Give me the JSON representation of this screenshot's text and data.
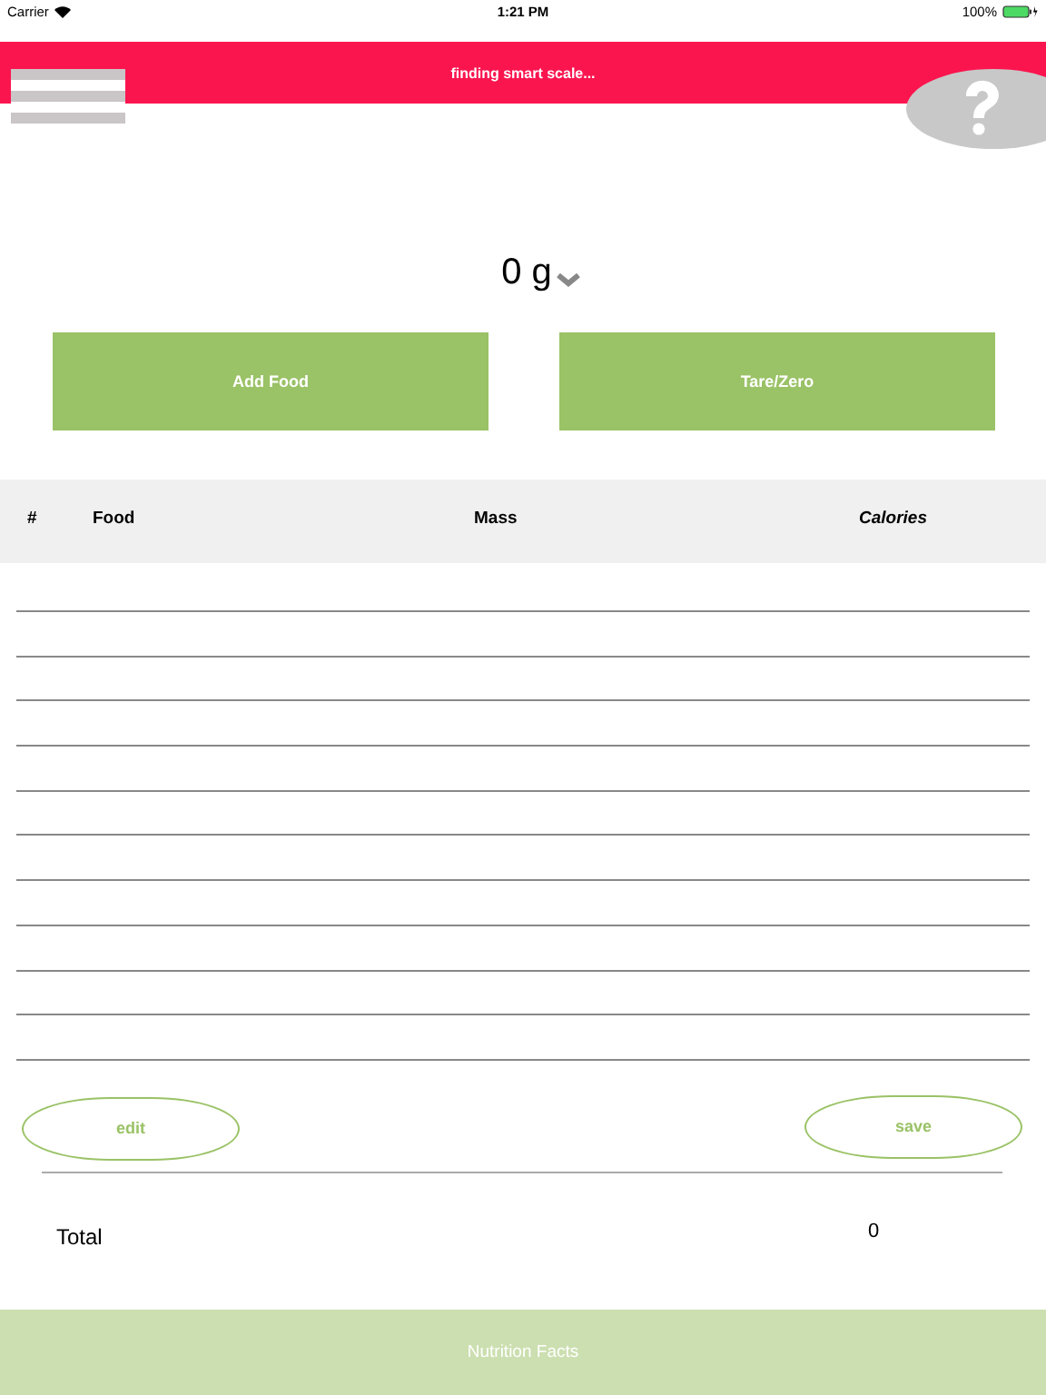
{
  "status_bar": {
    "carrier": "Carrier",
    "time": "1:21 PM",
    "battery": "100%"
  },
  "banner": {
    "message": "finding smart scale..."
  },
  "scale": {
    "reading": "0 g"
  },
  "actions": [
    "Add Food",
    "Tare/Zero"
  ],
  "table": {
    "columns": [
      {
        "label": "#",
        "italic": false
      },
      {
        "label": "Food",
        "italic": false
      },
      {
        "label": "Mass",
        "italic": false
      },
      {
        "label": "Calories",
        "italic": true
      }
    ]
  },
  "buttons": {
    "edit": "edit",
    "save": "save"
  },
  "total": {
    "label": "Total",
    "value": "0"
  },
  "footer": {
    "label": "Nutrition Facts"
  }
}
